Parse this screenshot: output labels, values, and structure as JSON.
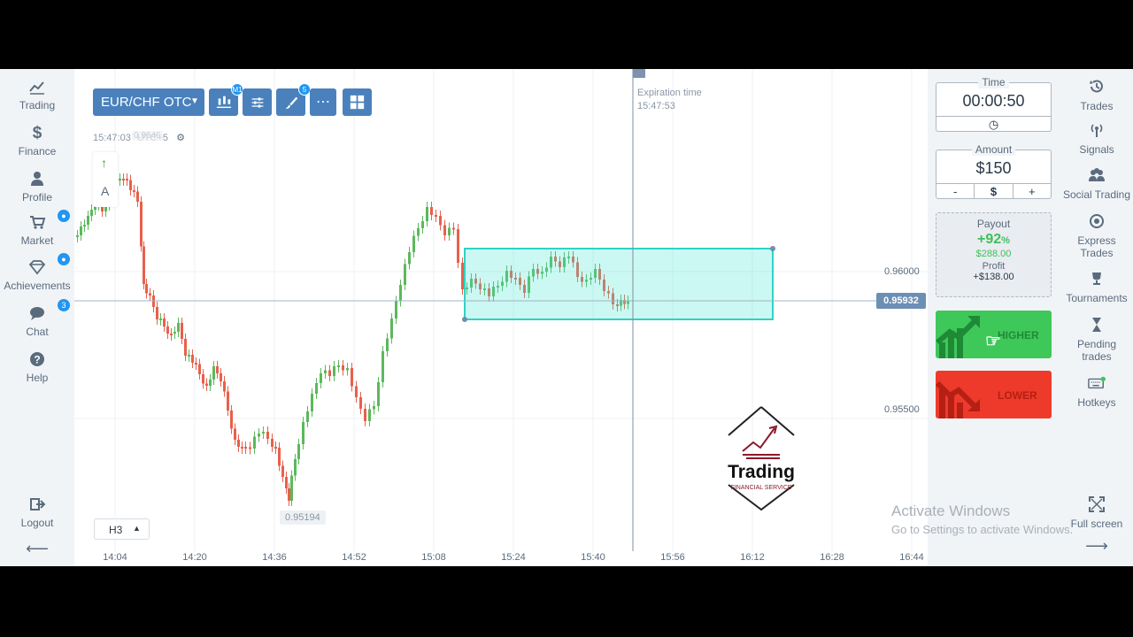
{
  "left_nav": {
    "items": [
      {
        "label": "Trading",
        "icon": "line-chart-icon"
      },
      {
        "label": "Finance",
        "icon": "dollar-icon"
      },
      {
        "label": "Profile",
        "icon": "user-icon"
      },
      {
        "label": "Market",
        "icon": "cart-icon"
      },
      {
        "label": "Achievements",
        "icon": "diamond-icon"
      },
      {
        "label": "Chat",
        "icon": "chat-icon",
        "badge": "3"
      },
      {
        "label": "Help",
        "icon": "help-icon"
      }
    ],
    "logout_label": "Logout"
  },
  "toolbar": {
    "asset_label": "EUR/CHF OTC",
    "timeframe_badge": "M1",
    "drawing_badge": "5",
    "clock": "15:47:03",
    "timezone": "UTC+5",
    "price_ghost": "0.9646"
  },
  "chart": {
    "expiration_label": "Expiration time",
    "expiration_time": "15:47:53",
    "current_price": "0.95932",
    "price_levels": [
      "0.96000",
      "0.95500"
    ],
    "low_label": "0.95194",
    "time_labels": [
      "14:04",
      "14:20",
      "14:36",
      "14:52",
      "15:08",
      "15:24",
      "15:40",
      "15:56",
      "16:12",
      "16:28",
      "16:44"
    ],
    "timeframe_selector": "H3",
    "up_color": "#5cb85c",
    "down_color": "#e8604c"
  },
  "watermark": {
    "brand": "Trading",
    "tagline": "FINANCIAL SERVICE"
  },
  "activation": {
    "title": "Activate Windows",
    "subtitle": "Go to Settings to activate Windows."
  },
  "trade_panel": {
    "time_label": "Time",
    "time_value": "00:00:50",
    "amount_label": "Amount",
    "amount_value": "$150",
    "amount_minus": "-",
    "amount_currency": "$",
    "amount_plus": "+",
    "payout_label": "Payout",
    "payout_percent": "+92",
    "payout_percent_sign": "%",
    "payout_amount": "$288.00",
    "profit_label": "Profit",
    "profit_value": "+$138.00",
    "higher_label": "HIGHER",
    "lower_label": "LOWER",
    "higher_color": "#3fc85a",
    "lower_color": "#ee3a2b"
  },
  "right_nav": {
    "items": [
      {
        "label": "Trades",
        "icon": "history-icon"
      },
      {
        "label": "Signals",
        "icon": "signal-icon"
      },
      {
        "label": "Social Trading",
        "icon": "people-icon"
      },
      {
        "label": "Express Trades",
        "icon": "target-icon"
      },
      {
        "label": "Tournaments",
        "icon": "trophy-icon"
      },
      {
        "label": "Pending trades",
        "icon": "hourglass-icon"
      },
      {
        "label": "Hotkeys",
        "icon": "keyboard-icon"
      }
    ],
    "fullscreen_label": "Full screen"
  }
}
